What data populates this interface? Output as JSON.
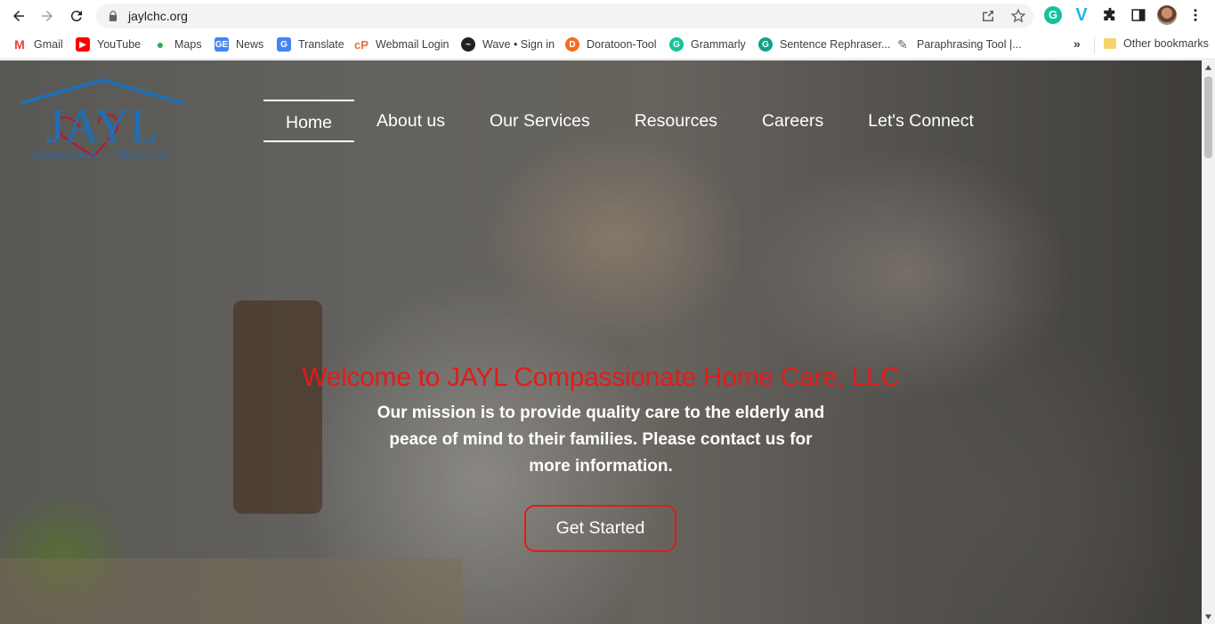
{
  "browser": {
    "url": "jaylchc.org",
    "bookmarks": [
      {
        "label": "Gmail",
        "icon": "gmail-icon",
        "color": "#ea4335"
      },
      {
        "label": "YouTube",
        "icon": "youtube-icon",
        "color": "#ff0000"
      },
      {
        "label": "Maps",
        "icon": "maps-icon",
        "color": "#34a853"
      },
      {
        "label": "News",
        "icon": "news-icon",
        "color": "#4285f4"
      },
      {
        "label": "Translate",
        "icon": "translate-icon",
        "color": "#4285f4"
      },
      {
        "label": "Webmail Login",
        "icon": "webmail-icon",
        "color": "#f06a35"
      },
      {
        "label": "Wave • Sign in",
        "icon": "wave-icon",
        "color": "#222222"
      },
      {
        "label": "Doratoon-Tool",
        "icon": "doratoon-icon",
        "color": "#f36c21"
      },
      {
        "label": "Grammarly",
        "icon": "grammarly-icon",
        "color": "#15c39a"
      },
      {
        "label": "Sentence Rephraser...",
        "icon": "rephraser-icon",
        "color": "#15a08a"
      },
      {
        "label": "Paraphrasing Tool |...",
        "icon": "paraphrasing-icon",
        "color": "#666666"
      }
    ],
    "more_label": "»",
    "other_bookmarks": "Other bookmarks"
  },
  "site": {
    "logo_text": "JAYL",
    "logo_tagline_left": "Compassionate",
    "logo_tagline_right": "Home Care",
    "nav": [
      "Home",
      "About us",
      "Our Services",
      "Resources",
      "Careers",
      "Let's Connect"
    ],
    "active_nav": "Home",
    "hero_title": "Welcome to JAYL Compassionate Home Care, LLC",
    "hero_text": "Our mission is to provide quality care to the elderly and peace of mind to their families. Please contact us for more information.",
    "cta_label": "Get Started",
    "accent_color": "#e31b1b",
    "logo_color": "#1e6fb8"
  }
}
